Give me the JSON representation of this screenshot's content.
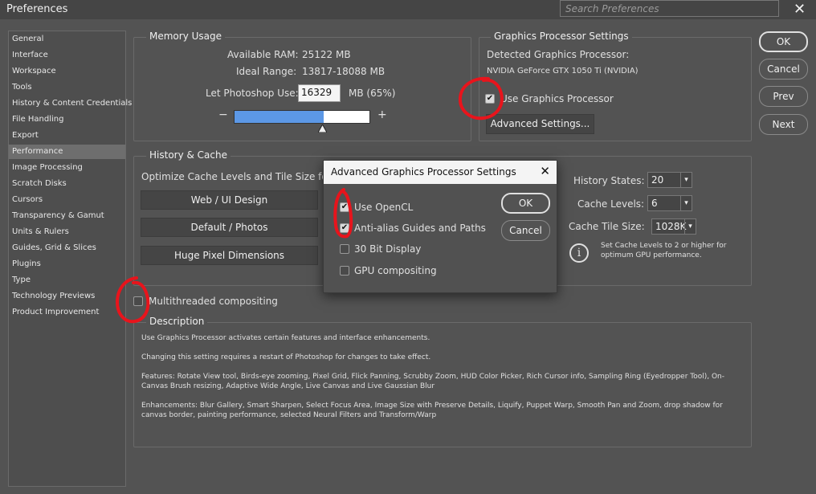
{
  "window": {
    "title": "Preferences",
    "search_placeholder": "Search Preferences"
  },
  "sidebar": {
    "items": [
      {
        "label": "General"
      },
      {
        "label": "Interface"
      },
      {
        "label": "Workspace"
      },
      {
        "label": "Tools"
      },
      {
        "label": "History & Content Credentials"
      },
      {
        "label": "File Handling"
      },
      {
        "label": "Export"
      },
      {
        "label": "Performance",
        "active": true
      },
      {
        "label": "Image Processing"
      },
      {
        "label": "Scratch Disks"
      },
      {
        "label": "Cursors"
      },
      {
        "label": "Transparency & Gamut"
      },
      {
        "label": "Units & Rulers"
      },
      {
        "label": "Guides, Grid & Slices"
      },
      {
        "label": "Plugins"
      },
      {
        "label": "Type"
      },
      {
        "label": "Technology Previews"
      },
      {
        "label": "Product Improvement"
      }
    ]
  },
  "memory": {
    "legend": "Memory Usage",
    "available_label": "Available RAM:",
    "available_value": "25122 MB",
    "ideal_label": "Ideal Range:",
    "ideal_value": "13817-18088 MB",
    "let_use_label": "Let Photoshop Use:",
    "let_use_value": "16329",
    "let_use_unit": "MB (65%)",
    "slider_fraction": 0.65,
    "minus": "−",
    "plus": "+"
  },
  "gpu": {
    "legend": "Graphics Processor Settings",
    "detected_label": "Detected Graphics Processor:",
    "detected_value": "NVIDIA GeForce GTX 1050 Ti (NVIDIA)",
    "use_gpu_label": "Use Graphics Processor",
    "use_gpu_checked": true,
    "advanced_button": "Advanced Settings..."
  },
  "history_cache": {
    "legend": "History & Cache",
    "optimize_label": "Optimize Cache Levels and Tile Size for:",
    "buttons": [
      "Web / UI Design",
      "Default / Photos",
      "Huge Pixel Dimensions"
    ],
    "history_states_label": "History States:",
    "history_states_value": "20",
    "cache_levels_label": "Cache Levels:",
    "cache_levels_value": "6",
    "cache_tile_label": "Cache Tile Size:",
    "cache_tile_value": "1028K",
    "info_text_1": "Set Cache Levels to 2 or higher for",
    "info_text_2": "optimum GPU performance."
  },
  "multithreaded": {
    "label": "Multithreaded compositing",
    "checked": false
  },
  "description": {
    "legend": "Description",
    "p1": "Use Graphics Processor activates certain features and interface enhancements.",
    "p2": "Changing this setting requires a restart of Photoshop for changes to take effect.",
    "p3a": "Features: Rotate View tool, Birds-eye zooming, Pixel Grid, Flick Panning, Scrubby Zoom, HUD Color Picker, Rich Cursor info, Sampling Ring (Eyedropper Tool), On-",
    "p3b": "Canvas Brush resizing, Adaptive Wide Angle, Live Canvas and Live Gaussian Blur",
    "p4a": "Enhancements: Blur Gallery, Smart Sharpen, Select Focus Area, Image Size with Preserve Details, Liquify, Puppet Warp, Smooth Pan and Zoom, drop shadow for",
    "p4b": "canvas border, painting performance, selected Neural Filters and Transform/Warp"
  },
  "main_buttons": {
    "ok": "OK",
    "cancel": "Cancel",
    "prev": "Prev",
    "next": "Next"
  },
  "advanced_dialog": {
    "title": "Advanced Graphics Processor Settings",
    "options": [
      {
        "label": "Use OpenCL",
        "checked": true
      },
      {
        "label": "Anti-alias Guides and Paths",
        "checked": true
      },
      {
        "label": "30 Bit Display",
        "checked": false
      },
      {
        "label": "GPU compositing",
        "checked": false
      }
    ],
    "ok": "OK",
    "cancel": "Cancel"
  },
  "colors": {
    "background": "#535353",
    "slider_fill": "#5c98e6",
    "annotation_red": "#e8141c"
  }
}
